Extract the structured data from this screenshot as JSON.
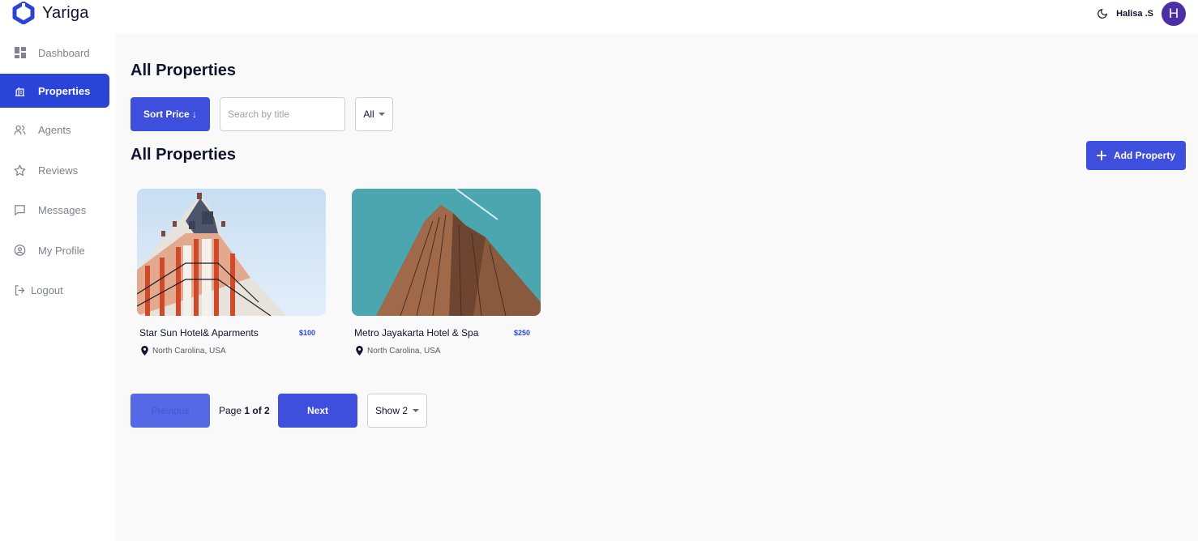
{
  "app": {
    "name": "Yariga",
    "brand_color": "#2b44d8"
  },
  "header": {
    "username": "Halisa .S",
    "avatar_initial": "H",
    "theme_icon": "moon-icon"
  },
  "sidebar": {
    "items": [
      {
        "label": "Dashboard",
        "icon": "dashboard-icon",
        "active": false
      },
      {
        "label": "Properties",
        "icon": "building-icon",
        "active": true
      },
      {
        "label": "Agents",
        "icon": "people-icon",
        "active": false
      },
      {
        "label": "Reviews",
        "icon": "star-icon",
        "active": false
      },
      {
        "label": "Messages",
        "icon": "chat-icon",
        "active": false
      },
      {
        "label": "My Profile",
        "icon": "user-circle-icon",
        "active": false
      }
    ],
    "logout": {
      "label": "Logout",
      "icon": "logout-icon"
    }
  },
  "main": {
    "page_title": "All Properties",
    "filters": {
      "sort_label": "Sort Price ↓",
      "search_placeholder": "Search by title",
      "search_value": "",
      "type_selected": "All"
    },
    "section_title": "All Properties",
    "add_button_label": "Add Property",
    "properties": [
      {
        "name": "Star Sun Hotel& Aparments",
        "price": "$100",
        "location": "North Carolina, USA"
      },
      {
        "name": "Metro Jayakarta Hotel & Spa",
        "price": "$250",
        "location": "North Carolina, USA"
      }
    ],
    "pagination": {
      "previous_label": "Previous",
      "page_word": "Page",
      "page_of": "1 of 2",
      "next_label": "Next",
      "show_selected": "Show 2"
    }
  }
}
